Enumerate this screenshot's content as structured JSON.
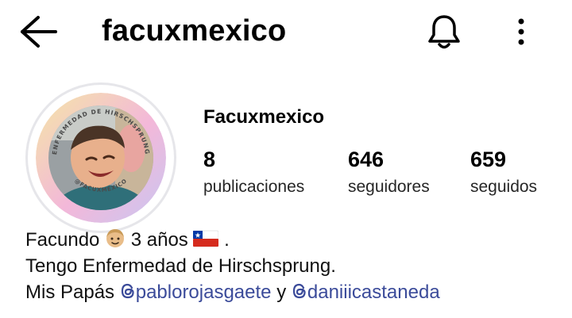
{
  "header": {
    "username": "facuxmexico"
  },
  "icons": {
    "back": "arrow-left-icon",
    "notifications": "bell-icon",
    "more": "more-vertical-icon",
    "mention_threads": "threads-icon"
  },
  "profile": {
    "display_name": "Facuxmexico",
    "avatar_ring_top_text": "ENFERMEDAD DE HIRSCHSPRUNG",
    "avatar_ring_bottom_text": "@FACUXMEXICO",
    "stats": [
      {
        "count": "8",
        "label": "publicaciones"
      },
      {
        "count": "646",
        "label": "seguidores"
      },
      {
        "count": "659",
        "label": "seguidos"
      }
    ]
  },
  "bio": {
    "line1_name": "Facundo",
    "line1_age": "3 años",
    "line1_end": ".",
    "line2": "Tengo Enfermedad de Hirschsprung.",
    "line3_prefix": "Mis Papás",
    "mention1": "pablorojasgaete",
    "connector": "y",
    "mention2": "daniiicastaneda"
  },
  "colors": {
    "mention": "#3b4b9a",
    "ring_gradient": [
      "#f4e6a6",
      "#f3b8d9",
      "#c9c6f2"
    ]
  }
}
